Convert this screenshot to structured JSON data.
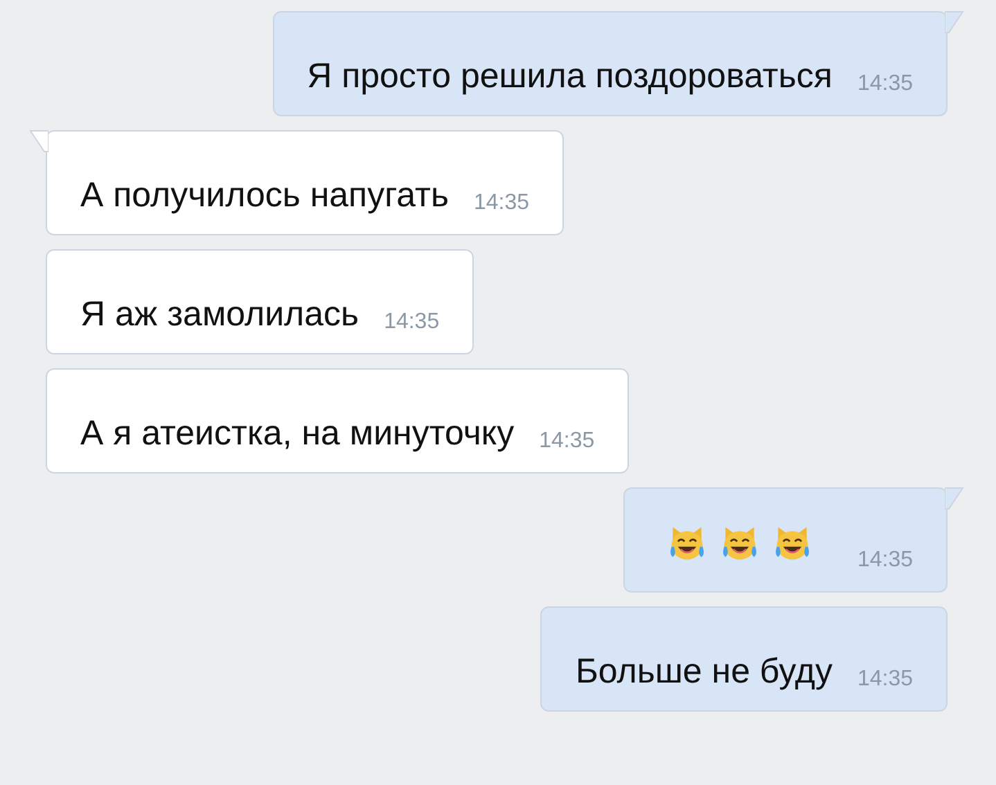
{
  "messages": [
    {
      "outgoing": true,
      "tail": true,
      "kind": "text",
      "text": "Я просто решила поздороваться",
      "time": "14:35"
    },
    {
      "outgoing": false,
      "tail": true,
      "kind": "text",
      "text": "А получилось напугать",
      "time": "14:35"
    },
    {
      "outgoing": false,
      "tail": false,
      "kind": "text",
      "text": "Я аж замолилась",
      "time": "14:35"
    },
    {
      "outgoing": false,
      "tail": false,
      "kind": "text",
      "text": "А я атеистка, на минуточку",
      "time": "14:35"
    },
    {
      "outgoing": true,
      "tail": true,
      "kind": "emoji",
      "emojis": [
        {
          "kind": "cat-tears-of-joy"
        },
        {
          "kind": "cat-tears-of-joy"
        },
        {
          "kind": "cat-tears-of-joy"
        }
      ],
      "time": "14:35"
    },
    {
      "outgoing": true,
      "tail": false,
      "kind": "text",
      "text": "Больше не буду",
      "time": "14:35"
    }
  ]
}
